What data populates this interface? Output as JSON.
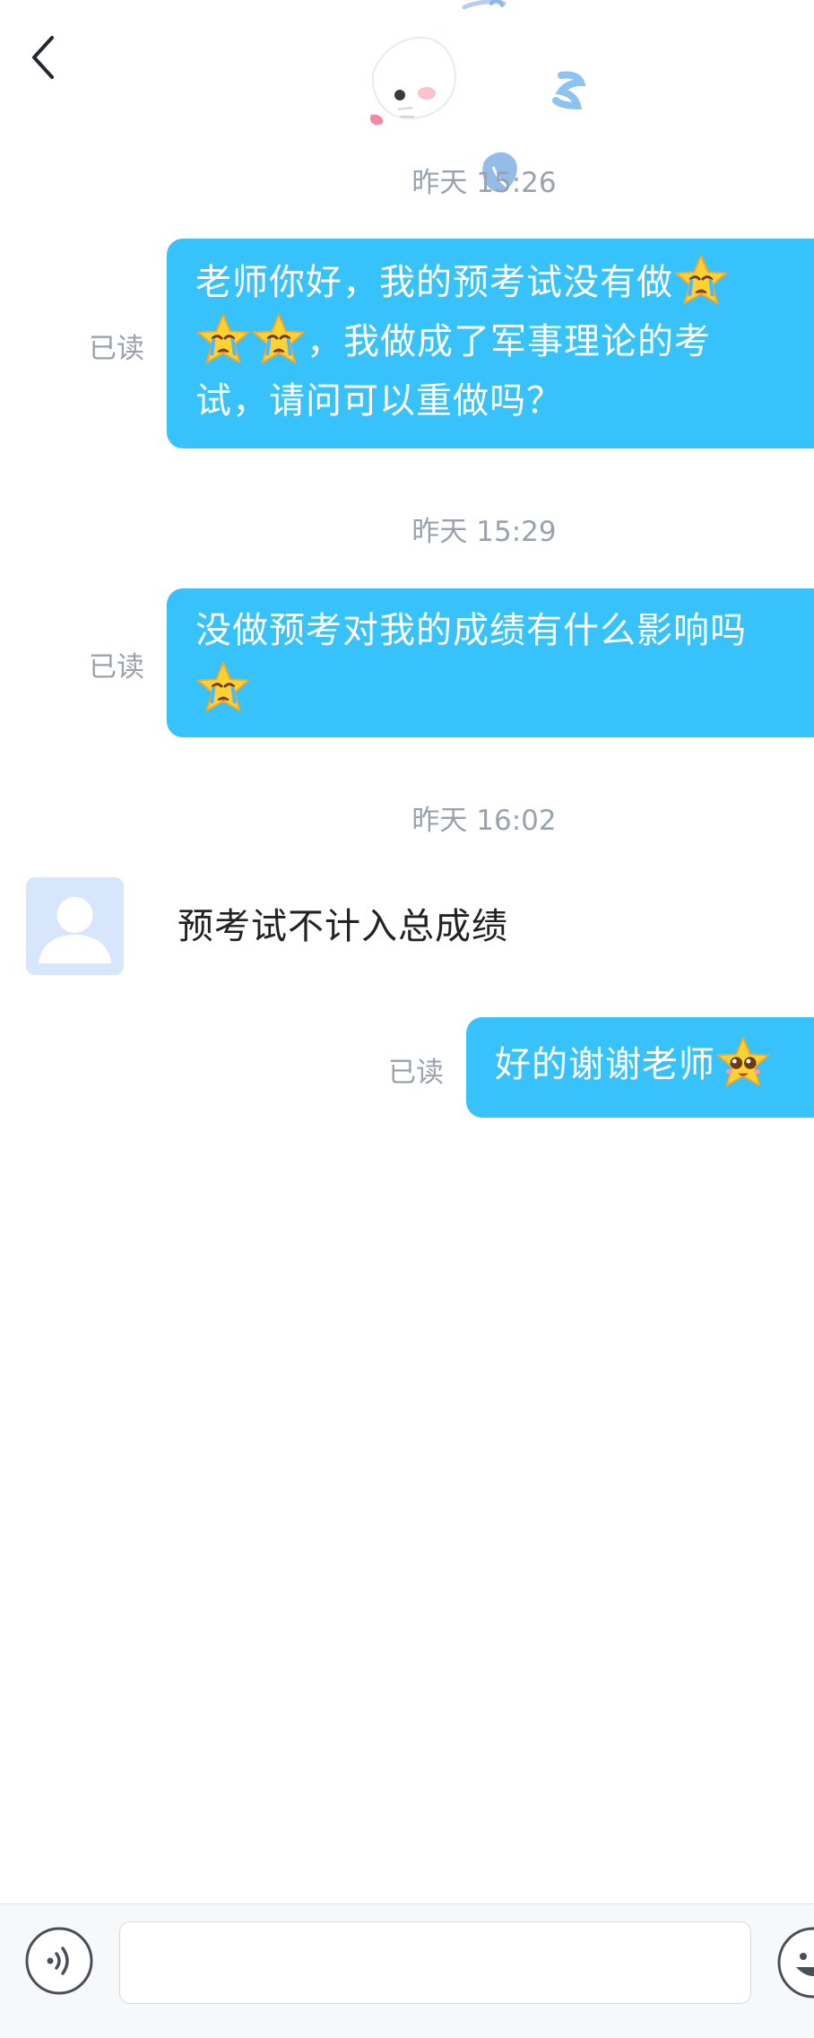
{
  "header": {
    "back_icon": "chevron-left-icon",
    "decoration": "bunny-sticker"
  },
  "conversation": [
    {
      "type": "timestamp",
      "text": "昨天 15:26"
    },
    {
      "type": "outgoing",
      "read": "已读",
      "lines": [
        "老师你好，我的预考试没有做",
        "，我做成了军事理论的考",
        "试，请问可以重做吗？"
      ],
      "emoji": "crying-star-emoji"
    },
    {
      "type": "timestamp",
      "text": "昨天 15:29"
    },
    {
      "type": "outgoing",
      "read": "已读",
      "lines": [
        "没做预考对我的成绩有什么影响吗"
      ],
      "emoji": "crying-star-emoji"
    },
    {
      "type": "timestamp",
      "text": "昨天 16:02"
    },
    {
      "type": "incoming",
      "avatar": "default-avatar",
      "text": "预考试不计入总成绩"
    },
    {
      "type": "outgoing",
      "read": "已读",
      "text": "好的谢谢老师",
      "emoji": "starry-eyed-star-emoji"
    }
  ],
  "input_bar": {
    "voice_icon": "voice-icon",
    "input_value": "",
    "emoji_icon": "emoji-face-icon"
  },
  "colors": {
    "bubble": "#37c2fc",
    "timestamp": "#9aa3ad",
    "avatar_bg": "#d8e6fb"
  }
}
